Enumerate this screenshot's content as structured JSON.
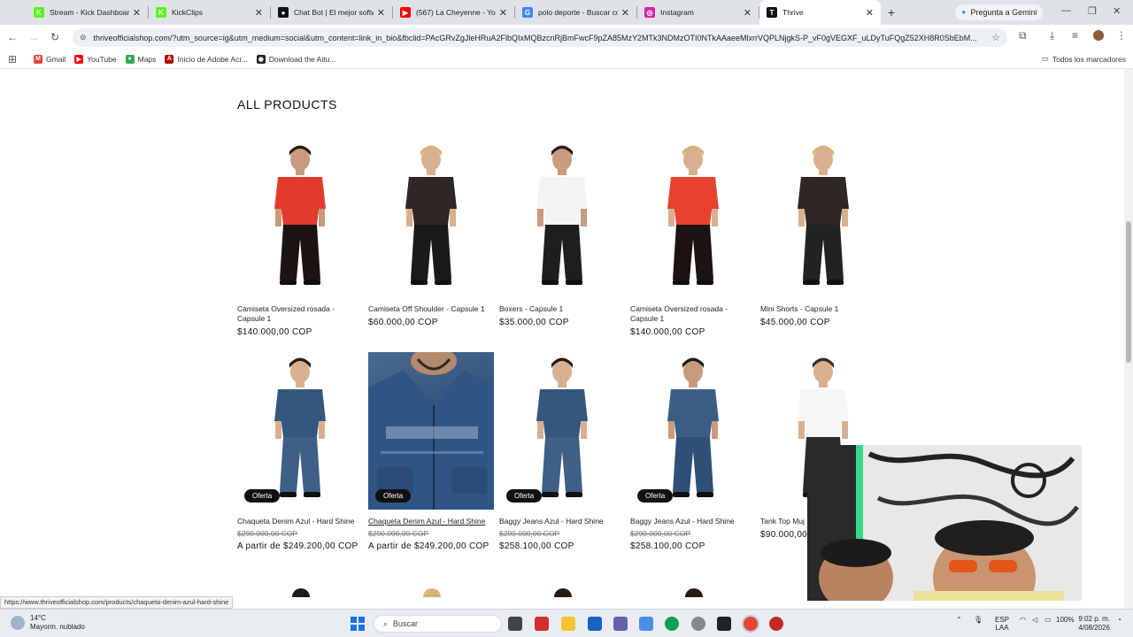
{
  "browser": {
    "tabs": [
      {
        "title": "Stream - Kick Dashboard",
        "color": "#53fc18",
        "glyph": "K",
        "active": false
      },
      {
        "title": "KickClips",
        "color": "#53fc18",
        "glyph": "K",
        "active": false
      },
      {
        "title": "Chat Bot | El mejor softw",
        "color": "#111111",
        "glyph": "●",
        "active": false
      },
      {
        "title": "(567) La Cheyenne - YouT",
        "color": "#ff0000",
        "glyph": "▶",
        "active": false
      },
      {
        "title": "polo deporte - Buscar co",
        "color": "#4285f4",
        "glyph": "G",
        "active": false
      },
      {
        "title": "Instagram",
        "color": "#d6249f",
        "glyph": "◎",
        "active": false
      },
      {
        "title": "Thrive",
        "color": "#111111",
        "glyph": "T",
        "active": true
      }
    ],
    "gemini_label": "Pregunta a Gemini",
    "url": "thriveofficialshop.com/?utm_source=ig&utm_medium=social&utm_content=link_in_bio&fbclid=PAcGRvZgJleHRuA2FlbQIxMQBzcnRjBmFwcF9pZA85MzY2MTk3NDMzOTI0NTkAAaeeMlxrrVQPLNjgkS-P_vF0gVEGXF_uLDyTuFQgZ52XH8R0SbEbM...",
    "bookmarks": [
      {
        "label": "Gmail",
        "color": "#ea4335",
        "glyph": "M"
      },
      {
        "label": "YouTube",
        "color": "#ff0000",
        "glyph": "▶"
      },
      {
        "label": "Maps",
        "color": "#34a853",
        "glyph": "●"
      },
      {
        "label": "Inicio de Adobe Acr...",
        "color": "#b30b00",
        "glyph": "A"
      },
      {
        "label": "Download the Aitu...",
        "color": "#222222",
        "glyph": "◉"
      }
    ],
    "all_bookmarks": "Todos los marcadores",
    "status_url": "https://www.thriveofficialshop.com/products/chaqueta-denim-azul-hard-shine"
  },
  "shop": {
    "section_title": "ALL PRODUCTS",
    "row1": [
      {
        "name": "Camiseta Oversized rosada - Capsule 1",
        "price": "$140.000,00 COP",
        "shirt": "#e23a2e",
        "pants": "#1c1411",
        "skin": "#c99a7e",
        "hair": "#2a1a12"
      },
      {
        "name": "Camiseta Off Shoulder - Capsule 1",
        "price": "$60.000,00 COP",
        "shirt": "#2e2723",
        "pants": "#1a1a1a",
        "skin": "#d9b08f",
        "hair": "#d6b27a"
      },
      {
        "name": "Boxers - Capsule 1",
        "price": "$35.000,00 COP",
        "shirt": "#f4f4f2",
        "pants": "#1e1e1e",
        "skin": "#c99a7e",
        "hair": "#2a1a12"
      },
      {
        "name": "Camiseta Oversized rosada - Capsule 1",
        "price": "$140.000,00 COP",
        "shirt": "#e6422f",
        "pants": "#1c1411",
        "skin": "#d9b08f",
        "hair": "#d6b27a"
      },
      {
        "name": "Mini Shorts - Capsule 1",
        "price": "$45.000,00 COP",
        "shirt": "#2e2723",
        "pants": "#222222",
        "skin": "#d9b08f",
        "hair": "#d6b27a"
      }
    ],
    "row2": [
      {
        "name": "Chaqueta Denim Azul - Hard Shine",
        "old_price": "$290.000,00 COP",
        "price": "A partir de $249.200,00 COP",
        "badge": "Oferta",
        "shirt": "#35577f",
        "pants": "#3d5f88",
        "skin": "#d9b08f",
        "hair": "#2a1a12",
        "hover": false
      },
      {
        "name": "Chaqueta Denim Azul - Hard Shine",
        "old_price": "$290.000,00 COP",
        "price": "A partir de $249.200,00 COP",
        "badge": "Oferta",
        "hover": true
      },
      {
        "name": "Baggy Jeans Azul - Hard Shine",
        "old_price": "$290.000,00 COP",
        "price": "$258.100,00 COP",
        "badge": "Oferta",
        "shirt": "#35577f",
        "pants": "#3d5f88",
        "skin": "#d9b08f",
        "hair": "#2a1a12",
        "hover": false
      },
      {
        "name": "Baggy Jeans Azul - Hard Shine",
        "old_price": "$290.000,00 COP",
        "price": "$258.100,00 COP",
        "badge": "Oferta",
        "shirt": "#3a5d86",
        "pants": "#2f4f78",
        "skin": "#c99a7e",
        "hair": "#1b1b1b",
        "hover": false
      },
      {
        "name": "Tank Top Muj",
        "price": "$90.000,00",
        "shirt": "#f6f6f4",
        "pants": "#2a2a2a",
        "skin": "#d9b08f",
        "hair": "#3a2a1e",
        "hover": false
      }
    ]
  },
  "taskbar": {
    "weather_temp": "14°C",
    "weather_desc": "Mayorm. nublado",
    "search_placeholder": "Buscar",
    "lang_top": "ESP",
    "lang_bottom": "LAA",
    "battery": "100%",
    "time": "9:02 p. m.",
    "date": "4/08/2026"
  }
}
